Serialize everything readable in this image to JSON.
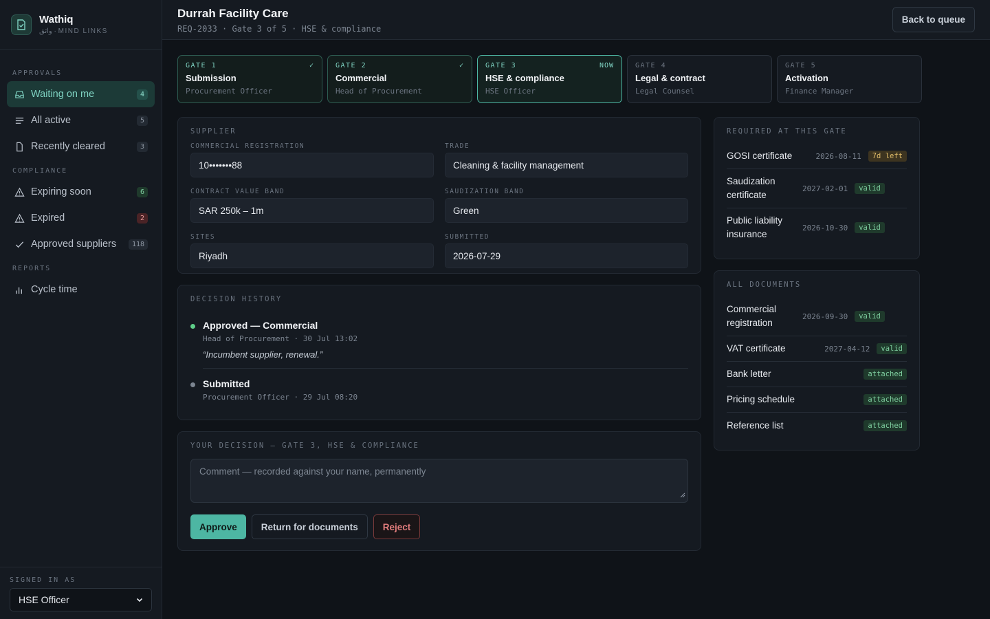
{
  "brand": {
    "name": "Wathiq",
    "sub": "واثق · MIND LINKS"
  },
  "sidebar": {
    "sections": [
      {
        "label": "APPROVALS",
        "items": [
          {
            "label": "Waiting on me",
            "count": "4",
            "icon": "inbox-icon"
          },
          {
            "label": "All active",
            "count": "5",
            "icon": "list-icon"
          },
          {
            "label": "Recently cleared",
            "count": "3",
            "icon": "file-icon"
          }
        ]
      },
      {
        "label": "COMPLIANCE",
        "items": [
          {
            "label": "Expiring soon",
            "count": "6",
            "icon": "warning-icon"
          },
          {
            "label": "Expired",
            "count": "2",
            "icon": "warning-icon"
          },
          {
            "label": "Approved suppliers",
            "count": "118",
            "icon": "check-icon"
          }
        ]
      },
      {
        "label": "REPORTS",
        "items": [
          {
            "label": "Cycle time",
            "icon": "bar-chart-icon"
          }
        ]
      }
    ],
    "signed_in_label": "SIGNED IN AS",
    "signed_in_value": "HSE Officer"
  },
  "header": {
    "title": "Durrah Facility Care",
    "subtitle": "REQ-2033 · Gate 3 of 5 · HSE & compliance",
    "back_label": "Back to queue"
  },
  "gates": [
    {
      "num": "GATE 1",
      "title": "Submission",
      "role": "Procurement Officer",
      "flag": "✓",
      "state": "done"
    },
    {
      "num": "GATE 2",
      "title": "Commercial",
      "role": "Head of Procurement",
      "flag": "✓",
      "state": "done"
    },
    {
      "num": "GATE 3",
      "title": "HSE & compliance",
      "role": "HSE Officer",
      "flag": "NOW",
      "state": "now"
    },
    {
      "num": "GATE 4",
      "title": "Legal & contract",
      "role": "Legal Counsel",
      "flag": "",
      "state": "pending"
    },
    {
      "num": "GATE 5",
      "title": "Activation",
      "role": "Finance Manager",
      "flag": "",
      "state": "pending"
    }
  ],
  "supplier": {
    "label": "SUPPLIER",
    "fields": [
      {
        "label": "COMMERCIAL REGISTRATION",
        "value": "10•••••••88"
      },
      {
        "label": "TRADE",
        "value": "Cleaning & facility management"
      },
      {
        "label": "CONTRACT VALUE BAND",
        "value": "SAR 250k – 1m"
      },
      {
        "label": "SAUDIZATION BAND",
        "value": "Green"
      },
      {
        "label": "SITES",
        "value": "Riyadh"
      },
      {
        "label": "SUBMITTED",
        "value": "2026-07-29"
      }
    ]
  },
  "history": {
    "label": "DECISION HISTORY",
    "items": [
      {
        "title": "Approved — Commercial",
        "meta": "Head of Procurement · 30 Jul 13:02",
        "quote": "“Incumbent supplier, renewal.”",
        "color": "#5fcf8a"
      },
      {
        "title": "Submitted",
        "meta": "Procurement Officer · 29 Jul 08:20",
        "color": "#7c8591"
      }
    ]
  },
  "decision": {
    "label": "YOUR DECISION — GATE 3, HSE & COMPLIANCE",
    "placeholder": "Comment — recorded against your name, permanently",
    "approve": "Approve",
    "return": "Return for documents",
    "reject": "Reject"
  },
  "required": {
    "label": "REQUIRED AT THIS GATE",
    "docs": [
      {
        "name": "GOSI certificate",
        "date": "2026-08-11",
        "status": "7d left",
        "kind": "warn"
      },
      {
        "name": "Saudization certificate",
        "date": "2027-02-01",
        "status": "valid",
        "kind": "valid"
      },
      {
        "name": "Public liability insurance",
        "date": "2026-10-30",
        "status": "valid",
        "kind": "valid"
      }
    ]
  },
  "all_documents": {
    "label": "ALL DOCUMENTS",
    "docs": [
      {
        "name": "Commercial registration",
        "date": "2026-09-30",
        "status": "valid",
        "kind": "valid"
      },
      {
        "name": "VAT certificate",
        "date": "2027-04-12",
        "status": "valid",
        "kind": "valid"
      },
      {
        "name": "Bank letter",
        "date": "",
        "status": "attached",
        "kind": "attached"
      },
      {
        "name": "Pricing schedule",
        "date": "",
        "status": "attached",
        "kind": "attached"
      },
      {
        "name": "Reference list",
        "date": "",
        "status": "attached",
        "kind": "attached"
      }
    ]
  }
}
